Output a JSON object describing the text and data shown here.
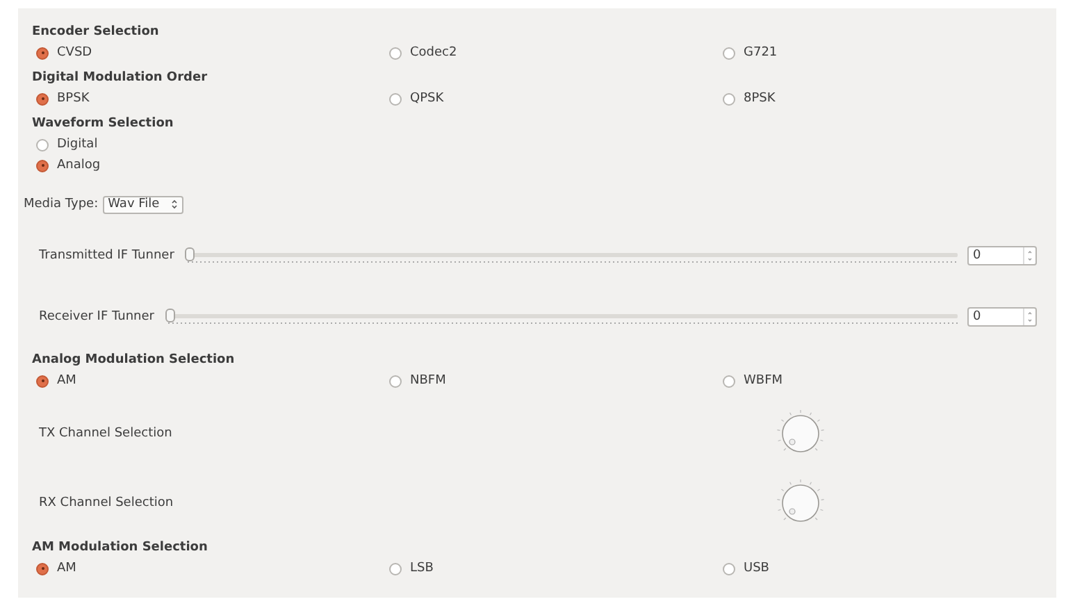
{
  "sections": [
    {
      "kind": "radio_group",
      "title": "Encoder Selection",
      "vertical": false,
      "options": [
        {
          "label": "CVSD",
          "selected": true
        },
        {
          "label": "Codec2",
          "selected": false
        },
        {
          "label": "G721",
          "selected": false
        }
      ]
    },
    {
      "kind": "radio_group",
      "title": "Digital Modulation Order",
      "vertical": false,
      "options": [
        {
          "label": "BPSK",
          "selected": true
        },
        {
          "label": "QPSK",
          "selected": false
        },
        {
          "label": "8PSK",
          "selected": false
        }
      ]
    },
    {
      "kind": "radio_group",
      "title": "Waveform Selection",
      "vertical": true,
      "options": [
        {
          "label": "Digital",
          "selected": false
        },
        {
          "label": "Analog",
          "selected": true
        }
      ]
    },
    {
      "kind": "combo",
      "label": "Media Type:",
      "value": "Wav File"
    },
    {
      "kind": "slider",
      "label": "Transmitted IF Tunner",
      "level": 0,
      "value": "0"
    },
    {
      "kind": "slider",
      "label": "Receiver IF Tunner",
      "level": 0,
      "value": "0"
    },
    {
      "kind": "radio_group",
      "title": "Analog Modulation Selection",
      "vertical": false,
      "options": [
        {
          "label": "AM",
          "selected": true
        },
        {
          "label": "NBFM",
          "selected": false
        },
        {
          "label": "WBFM",
          "selected": false
        }
      ]
    },
    {
      "kind": "knob",
      "label": "TX Channel Selection"
    },
    {
      "kind": "knob",
      "label": "RX Channel Selection"
    },
    {
      "kind": "radio_group",
      "title": "AM Modulation Selection",
      "vertical": false,
      "options": [
        {
          "label": "AM",
          "selected": true
        },
        {
          "label": "LSB",
          "selected": false
        },
        {
          "label": "USB",
          "selected": false
        }
      ]
    }
  ]
}
